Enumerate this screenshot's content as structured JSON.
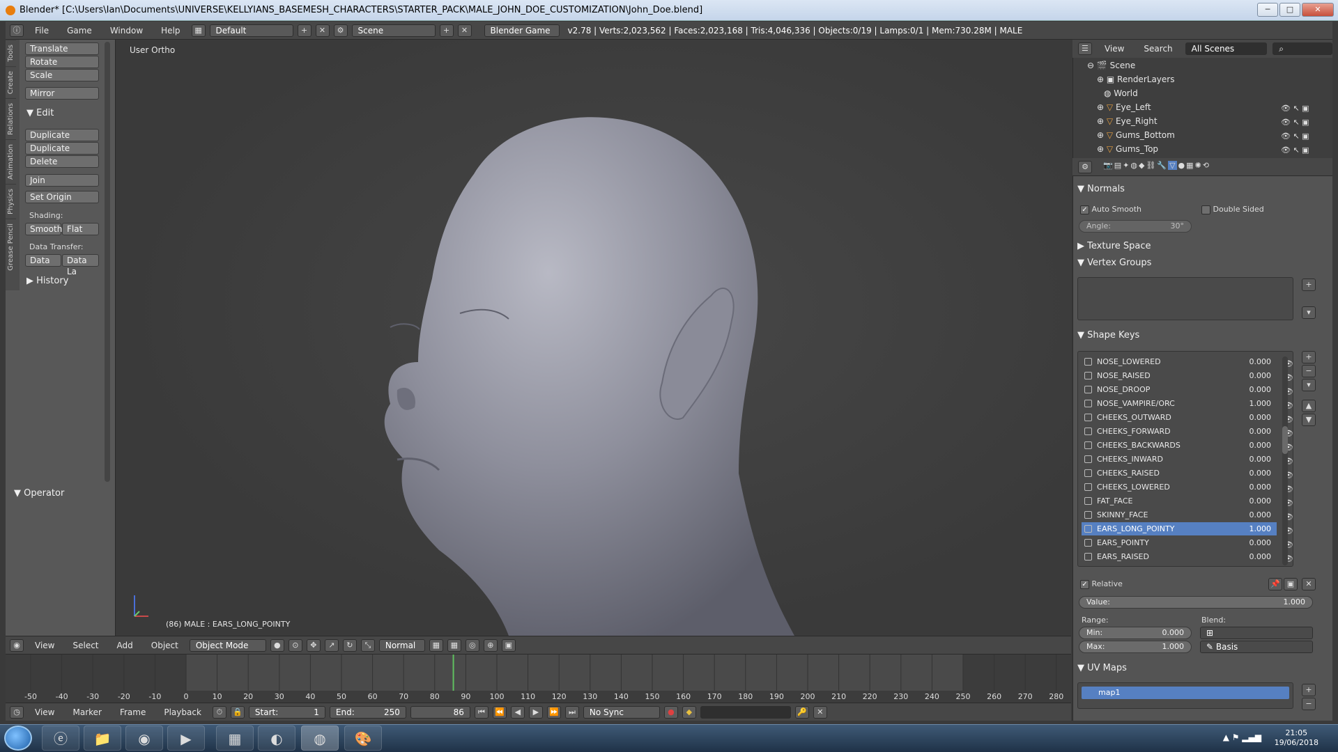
{
  "window": {
    "title": "Blender* [C:\\Users\\Ian\\Documents\\UNIVERSE\\KELLYIANS_BASEMESH_CHARACTERS\\STARTER_PACK\\MALE_JOHN_DOE_CUSTOMIZATION\\John_Doe.blend]",
    "minimize": "─",
    "maximize": "□",
    "close": "✕"
  },
  "menubar": {
    "file": "File",
    "game": "Game",
    "window": "Window",
    "help": "Help",
    "layout": "Default",
    "scene": "Scene",
    "engine": "Blender Game",
    "stats": "v2.78 | Verts:2,023,562 | Faces:2,023,168 | Tris:4,046,336 | Objects:0/19 | Lamps:0/1 | Mem:730.28M | MALE"
  },
  "toolshelf": {
    "tabs": [
      "Tools",
      "Create",
      "Relations",
      "Animation",
      "Physics",
      "Grease Pencil"
    ],
    "translate": "Translate",
    "rotate": "Rotate",
    "scale": "Scale",
    "mirror": "Mirror",
    "edit_header": "Edit",
    "duplicate": "Duplicate",
    "duplicate_linked": "Duplicate Linked",
    "delete": "Delete",
    "join": "Join",
    "set_origin": "Set Origin",
    "shading_label": "Shading:",
    "smooth": "Smooth",
    "flat": "Flat",
    "data_transfer_label": "Data Transfer:",
    "data": "Data",
    "data_la": "Data La",
    "history": "History",
    "operator": "Operator"
  },
  "viewport": {
    "view_label": "User Ortho",
    "object_info": "(86) MALE : EARS_LONG_POINTY"
  },
  "viewport_header": {
    "view": "View",
    "select": "Select",
    "add": "Add",
    "object": "Object",
    "mode": "Object Mode",
    "orientation": "Normal"
  },
  "timeline": {
    "ticks": [
      "-50",
      "-40",
      "-30",
      "-20",
      "-10",
      "0",
      "10",
      "20",
      "30",
      "40",
      "50",
      "60",
      "70",
      "80",
      "90",
      "100",
      "110",
      "120",
      "130",
      "140",
      "150",
      "160",
      "170",
      "180",
      "190",
      "200",
      "210",
      "220",
      "230",
      "240",
      "250",
      "260",
      "270",
      "280"
    ],
    "current_frame_marker": 86,
    "view": "View",
    "marker": "Marker",
    "frame": "Frame",
    "playback": "Playback",
    "start_label": "Start:",
    "start_value": "1",
    "end_label": "End:",
    "end_value": "250",
    "current": "86",
    "sync": "No Sync"
  },
  "outliner": {
    "view": "View",
    "search": "Search",
    "filter": "All Scenes",
    "items": [
      "Scene",
      "RenderLayers",
      "World",
      "Eye_Left",
      "Eye_Right",
      "Gums_Bottom",
      "Gums_Top"
    ]
  },
  "properties": {
    "normals": "Normals",
    "auto_smooth": "Auto Smooth",
    "double_sided": "Double Sided",
    "angle_label": "Angle:",
    "angle_value": "30°",
    "texture_space": "Texture Space",
    "vertex_groups": "Vertex Groups",
    "shape_keys": "Shape Keys",
    "shape_key_list": [
      {
        "name": "NOSE_LOWERED",
        "value": "0.000"
      },
      {
        "name": "NOSE_RAISED",
        "value": "0.000"
      },
      {
        "name": "NOSE_DROOP",
        "value": "0.000"
      },
      {
        "name": "NOSE_VAMPIRE/ORC",
        "value": "1.000"
      },
      {
        "name": "CHEEKS_OUTWARD",
        "value": "0.000"
      },
      {
        "name": "CHEEKS_FORWARD",
        "value": "0.000"
      },
      {
        "name": "CHEEKS_BACKWARDS",
        "value": "0.000"
      },
      {
        "name": "CHEEKS_INWARD",
        "value": "0.000"
      },
      {
        "name": "CHEEKS_RAISED",
        "value": "0.000"
      },
      {
        "name": "CHEEKS_LOWERED",
        "value": "0.000"
      },
      {
        "name": "FAT_FACE",
        "value": "0.000"
      },
      {
        "name": "SKINNY_FACE",
        "value": "0.000"
      },
      {
        "name": "EARS_LONG_POINTY",
        "value": "1.000"
      },
      {
        "name": "EARS_POINTY",
        "value": "0.000"
      },
      {
        "name": "EARS_RAISED",
        "value": "0.000"
      }
    ],
    "relative": "Relative",
    "value_label": "Value:",
    "value": "1.000",
    "range_label": "Range:",
    "blend_label": "Blend:",
    "min_label": "Min:",
    "min_value": "0.000",
    "max_label": "Max:",
    "max_value": "1.000",
    "blend_value": "Basis",
    "uv_maps": "UV Maps",
    "uv_map_name": "map1"
  },
  "taskbar": {
    "time": "21:05",
    "date": "19/06/2018"
  },
  "colors": {
    "accent": "#5680c2",
    "blender_orange": "#e87d0d",
    "frame_line": "#5fbf5f"
  }
}
